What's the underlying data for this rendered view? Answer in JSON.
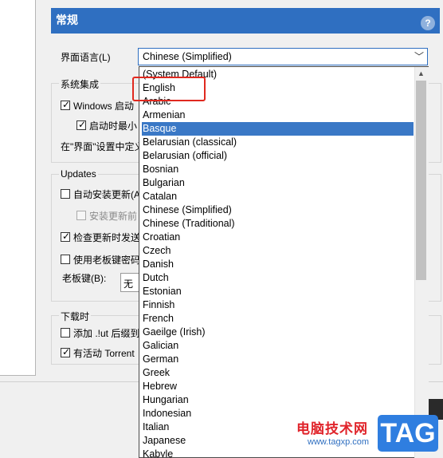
{
  "header": {
    "title": "常规",
    "help_glyph": "?"
  },
  "language": {
    "label": "界面语言(L)",
    "selected": "Chinese (Simplified)"
  },
  "system_integration": {
    "title": "系统集成",
    "windows_startup": "Windows 启动",
    "start_minimized": "启动时最小",
    "interface_settings": "在\"界面\"设置中定义"
  },
  "updates": {
    "title": "Updates",
    "auto_install": "自动安装更新(A",
    "notify_before": "安装更新前",
    "check_send": "检查更新时发送",
    "boss_key_password": "使用老板键密码",
    "boss_key_label": "老板键(B):",
    "boss_key_value": "无"
  },
  "download": {
    "title": "下载时",
    "add_suffix": "添加 .!ut 后缀到",
    "active_torrent": "有活动 Torrent"
  },
  "dropdown": {
    "options": [
      "(System Default)",
      "English",
      "Arabic",
      "Armenian",
      "Basque",
      "Belarusian (classical)",
      "Belarusian (official)",
      "Bosnian",
      "Bulgarian",
      "Catalan",
      "Chinese (Simplified)",
      "Chinese (Traditional)",
      "Croatian",
      "Czech",
      "Danish",
      "Dutch",
      "Estonian",
      "Finnish",
      "French",
      "Gaeilge (Irish)",
      "Galician",
      "German",
      "Greek",
      "Hebrew",
      "Hungarian",
      "Indonesian",
      "Italian",
      "Japanese",
      "Kabyle"
    ],
    "highlighted": "Basque"
  },
  "watermark": {
    "site": "电脑技术网",
    "url": "www.tagxp.com",
    "badge": "TAG"
  },
  "colors": {
    "header": "#2f6fc1",
    "highlight": "#3a78c6",
    "annotation": "#e0291f"
  }
}
